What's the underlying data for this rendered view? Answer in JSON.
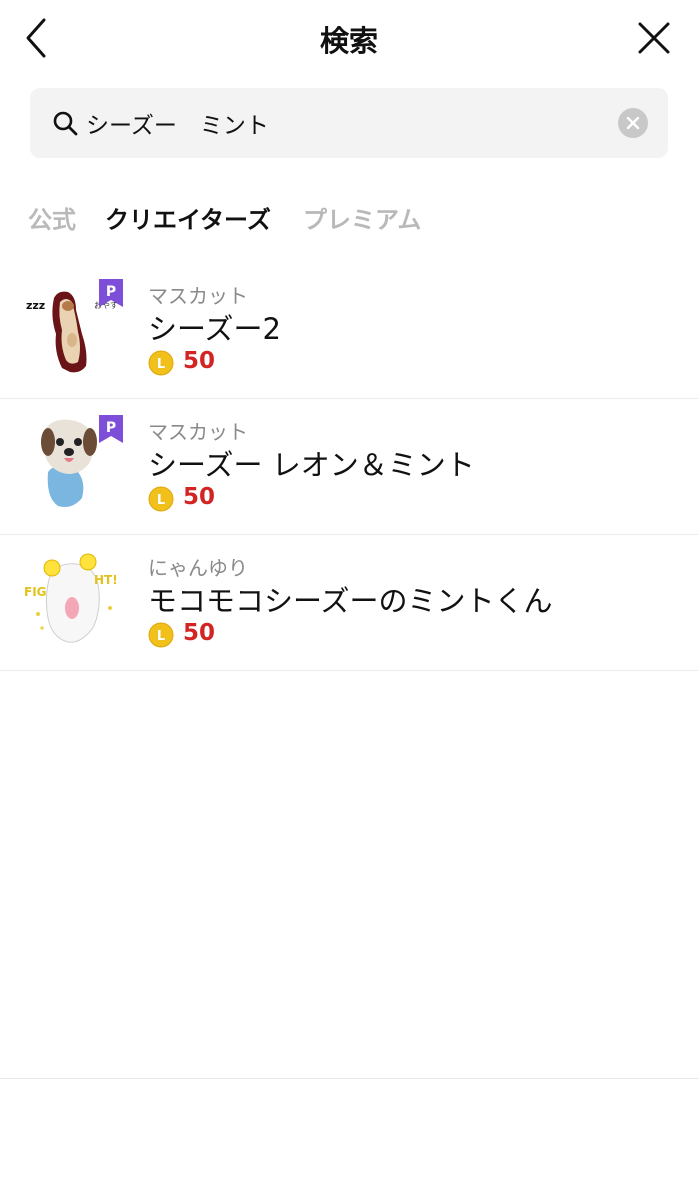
{
  "header": {
    "title": "検索",
    "back_icon": "chevron-left-icon",
    "close_icon": "close-icon"
  },
  "search": {
    "value": "シーズー　ミント",
    "placeholder": "",
    "icon": "search-icon",
    "clear_icon": "clear-icon"
  },
  "tabs": [
    {
      "label": "公式",
      "active": false
    },
    {
      "label": "クリエイターズ",
      "active": true
    },
    {
      "label": "プレミアム",
      "active": false
    }
  ],
  "results": [
    {
      "creator": "マスカット",
      "title": "シーズー2",
      "price": "50",
      "premium_badge": "P",
      "thumb_text_left": "zzz",
      "thumb_text_right": "おやす"
    },
    {
      "creator": "マスカット",
      "title": "シーズー レオン＆ミント",
      "price": "50",
      "premium_badge": "P"
    },
    {
      "creator": "にゃんゆり",
      "title": "モコモコシーズーのミントくん",
      "price": "50",
      "thumb_text_left": "FIG",
      "thumb_text_right": "HT!"
    }
  ],
  "coin_symbol": "L",
  "colors": {
    "price": "#d32424",
    "premium_badge": "#7d4fd8",
    "coin": "#f2c01b",
    "tab_active": "#111111",
    "tab_inactive": "#b9b9b9"
  }
}
